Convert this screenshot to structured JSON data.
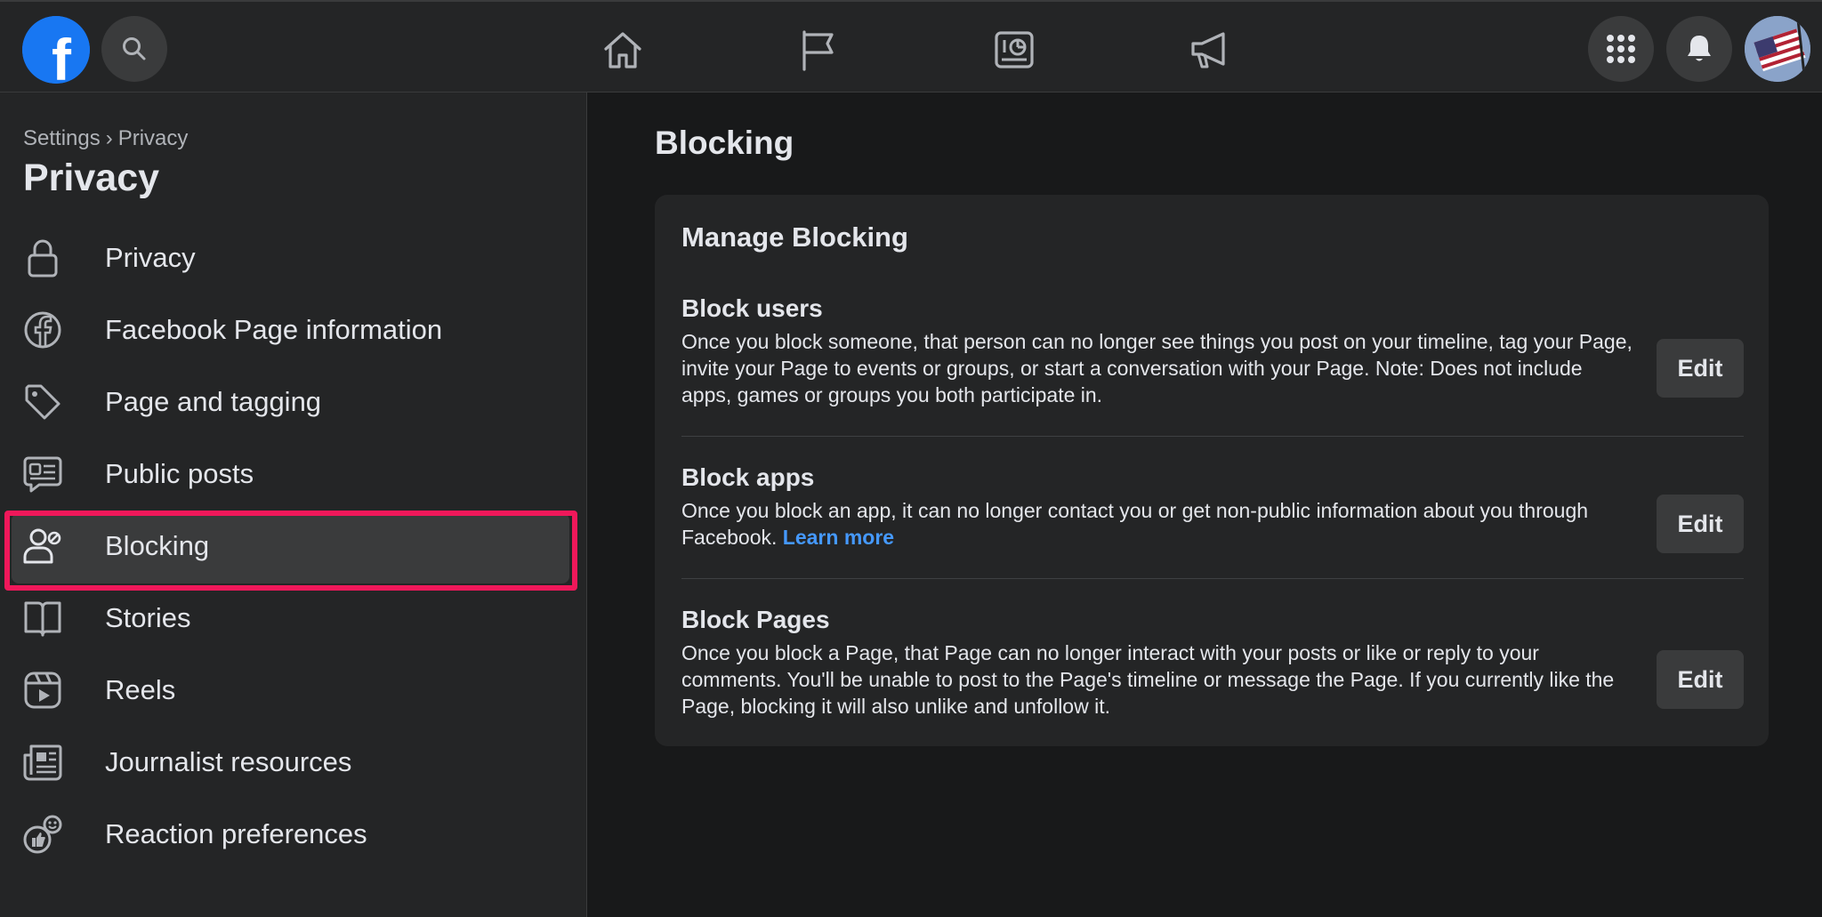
{
  "topbar": {
    "logo_letter": "f",
    "nav_icons": [
      "home-icon",
      "flag-icon",
      "insights-icon",
      "megaphone-icon"
    ],
    "right_icons": [
      "menu-grid-icon",
      "bell-icon",
      "avatar"
    ]
  },
  "sidebar": {
    "breadcrumb": {
      "parent": "Settings",
      "separator": "›",
      "current": "Privacy"
    },
    "title": "Privacy",
    "items": [
      {
        "label": "Privacy",
        "icon": "lock-icon"
      },
      {
        "label": "Facebook Page information",
        "icon": "facebook-circle-icon"
      },
      {
        "label": "Page and tagging",
        "icon": "tag-icon"
      },
      {
        "label": "Public posts",
        "icon": "comment-icon"
      },
      {
        "label": "Blocking",
        "icon": "block-user-icon",
        "active": true
      },
      {
        "label": "Stories",
        "icon": "book-icon"
      },
      {
        "label": "Reels",
        "icon": "reels-icon"
      },
      {
        "label": "Journalist resources",
        "icon": "newspaper-icon"
      },
      {
        "label": "Reaction preferences",
        "icon": "reaction-icon"
      }
    ]
  },
  "main": {
    "title": "Blocking",
    "card": {
      "title": "Manage Blocking",
      "sections": [
        {
          "heading": "Block users",
          "text": "Once you block someone, that person can no longer see things you post on your timeline, tag your Page, invite your Page to events or groups, or start a conversation with your Page. Note: Does not include apps, games or groups you both participate in.",
          "button": "Edit"
        },
        {
          "heading": "Block apps",
          "text": "Once you block an app, it can no longer contact you or get non-public information about you through Facebook.",
          "link": "Learn more",
          "button": "Edit"
        },
        {
          "heading": "Block Pages",
          "text": "Once you block a Page, that Page can no longer interact with your posts or like or reply to your comments. You'll be unable to post to the Page's timeline or message the Page. If you currently like the Page, blocking it will also unlike and unfollow it.",
          "button": "Edit"
        }
      ]
    }
  },
  "colors": {
    "background": "#18191a",
    "surface": "#242526",
    "button": "#3a3b3c",
    "brand": "#1877f2",
    "link": "#4599ff",
    "highlight": "#f0185a"
  }
}
